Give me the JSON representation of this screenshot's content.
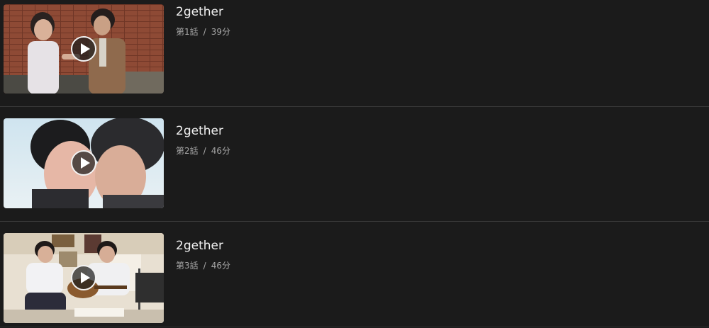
{
  "episodes": [
    {
      "title": "2gether",
      "episode_label": "第1話",
      "separator": "/",
      "duration": "39分"
    },
    {
      "title": "2gether",
      "episode_label": "第2話",
      "separator": "/",
      "duration": "46分"
    },
    {
      "title": "2gether",
      "episode_label": "第3話",
      "separator": "/",
      "duration": "46分"
    }
  ],
  "colors": {
    "background": "#1b1b1b",
    "divider": "#3a3a3a",
    "title_text": "#f0f0f0",
    "meta_text": "#a8a8a8"
  }
}
